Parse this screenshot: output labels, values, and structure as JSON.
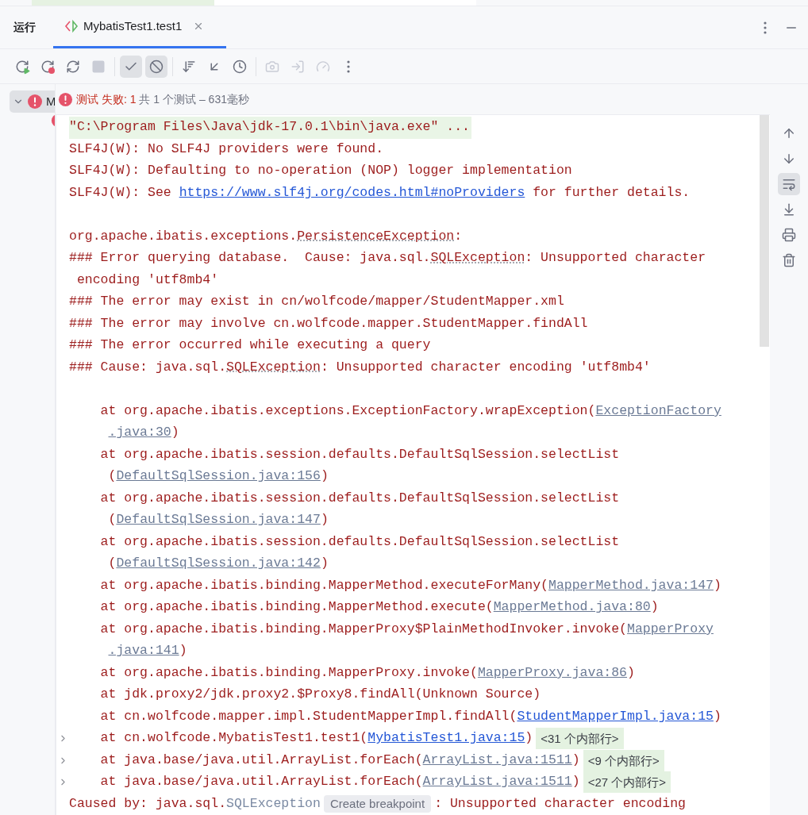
{
  "tool_window": {
    "title": "运行",
    "tabs": [
      {
        "label": "MybatisTest1.test1",
        "selected": true
      }
    ]
  },
  "toolbar": [
    {
      "kind": "rerun",
      "selected": false,
      "disabled": false
    },
    {
      "kind": "rerun_failed",
      "selected": false,
      "disabled": false
    },
    {
      "kind": "toggle_auto",
      "selected": false,
      "disabled": false
    },
    {
      "kind": "stop",
      "selected": false,
      "disabled": true
    },
    {
      "kind": "sep"
    },
    {
      "kind": "show_passed",
      "selected": true,
      "disabled": false
    },
    {
      "kind": "show_ignored",
      "selected": true,
      "disabled": false
    },
    {
      "kind": "sep"
    },
    {
      "kind": "sort",
      "selected": false,
      "disabled": false
    },
    {
      "kind": "collapse",
      "selected": false,
      "disabled": false
    },
    {
      "kind": "history",
      "selected": false,
      "disabled": false
    },
    {
      "kind": "sep"
    },
    {
      "kind": "snapshot",
      "selected": false,
      "disabled": true
    },
    {
      "kind": "import",
      "selected": false,
      "disabled": true
    },
    {
      "kind": "profile",
      "selected": false,
      "disabled": true
    },
    {
      "kind": "more",
      "selected": false
    }
  ],
  "tree": {
    "items": [
      {
        "label": "M",
        "failed": true,
        "selected": true,
        "expanded": true,
        "children": [
          {
            "failed": true
          }
        ]
      }
    ]
  },
  "status": {
    "result": "测试 失败: 1",
    "summary": "共 1 个测试 – 631毫秒"
  },
  "console": {
    "lines": [
      {
        "highlight": true,
        "segments": [
          {
            "kind": "plain",
            "text": "\"C:\\Program Files\\Java\\jdk-17.0.1\\bin\\java.exe\" ..."
          }
        ]
      },
      {
        "segments": [
          {
            "kind": "plain",
            "text": "SLF4J(W): No SLF4J providers were found."
          }
        ]
      },
      {
        "segments": [
          {
            "kind": "plain",
            "text": "SLF4J(W): Defaulting to no-operation (NOP) logger implementation"
          }
        ]
      },
      {
        "segments": [
          {
            "kind": "plain",
            "text": "SLF4J(W): See "
          },
          {
            "kind": "link",
            "text": "https://www.slf4j.org/codes.html#noProviders"
          },
          {
            "kind": "plain",
            "text": " for further details."
          }
        ]
      },
      {
        "kind": "blank"
      },
      {
        "segments": [
          {
            "kind": "plain",
            "text": "org.apache.ibatis.exceptions."
          },
          {
            "kind": "class_ref",
            "text": "PersistenceException"
          },
          {
            "kind": "plain",
            "text": ":"
          }
        ]
      },
      {
        "segments": [
          {
            "kind": "plain",
            "text": "### Error querying database.  Cause: java.sql."
          },
          {
            "kind": "class_ref",
            "text": "SQLException"
          },
          {
            "kind": "plain",
            "text": ": Unsupported character"
          }
        ]
      },
      {
        "segments": [
          {
            "kind": "plain",
            "text": " encoding 'utf8mb4'"
          }
        ]
      },
      {
        "segments": [
          {
            "kind": "plain",
            "text": "### The error may exist in cn/wolfcode/mapper/StudentMapper.xml"
          }
        ]
      },
      {
        "segments": [
          {
            "kind": "plain",
            "text": "### The error may involve cn.wolfcode.mapper.StudentMapper.findAll"
          }
        ]
      },
      {
        "segments": [
          {
            "kind": "plain",
            "text": "### The error occurred while executing a query"
          }
        ]
      },
      {
        "segments": [
          {
            "kind": "plain",
            "text": "### Cause: java.sql."
          },
          {
            "kind": "class_ref",
            "text": "SQLException"
          },
          {
            "kind": "plain",
            "text": ": Unsupported character encoding 'utf8mb4'"
          }
        ]
      },
      {
        "kind": "blank"
      },
      {
        "segments": [
          {
            "kind": "plain",
            "text": "    at org.apache.ibatis.exceptions.ExceptionFactory.wrapException("
          },
          {
            "kind": "file_link",
            "text": "ExceptionFactory"
          }
        ]
      },
      {
        "kind": "continuation",
        "segments": [
          {
            "kind": "file_link",
            "text": ".java:30"
          },
          {
            "kind": "plain",
            "text": ")"
          }
        ]
      },
      {
        "segments": [
          {
            "kind": "plain",
            "text": "    at org.apache.ibatis.session.defaults.DefaultSqlSession.selectList"
          }
        ]
      },
      {
        "segments": [
          {
            "kind": "plain",
            "text": "     ("
          },
          {
            "kind": "file_link",
            "text": "DefaultSqlSession.java:156"
          },
          {
            "kind": "plain",
            "text": ")"
          }
        ]
      },
      {
        "segments": [
          {
            "kind": "plain",
            "text": "    at org.apache.ibatis.session.defaults.DefaultSqlSession.selectList"
          }
        ]
      },
      {
        "segments": [
          {
            "kind": "plain",
            "text": "     ("
          },
          {
            "kind": "file_link",
            "text": "DefaultSqlSession.java:147"
          },
          {
            "kind": "plain",
            "text": ")"
          }
        ]
      },
      {
        "segments": [
          {
            "kind": "plain",
            "text": "    at org.apache.ibatis.session.defaults.DefaultSqlSession.selectList"
          }
        ]
      },
      {
        "segments": [
          {
            "kind": "plain",
            "text": "     ("
          },
          {
            "kind": "file_link",
            "text": "DefaultSqlSession.java:142"
          },
          {
            "kind": "plain",
            "text": ")"
          }
        ]
      },
      {
        "segments": [
          {
            "kind": "plain",
            "text": "    at org.apache.ibatis.binding.MapperMethod.executeForMany("
          },
          {
            "kind": "file_link",
            "text": "MapperMethod.java:147"
          },
          {
            "kind": "plain",
            "text": ")"
          }
        ]
      },
      {
        "segments": [
          {
            "kind": "plain",
            "text": "    at org.apache.ibatis.binding.MapperMethod.execute("
          },
          {
            "kind": "file_link",
            "text": "MapperMethod.java:80"
          },
          {
            "kind": "plain",
            "text": ")"
          }
        ]
      },
      {
        "segments": [
          {
            "kind": "plain",
            "text": "    at org.apache.ibatis.binding.MapperProxy$PlainMethodInvoker.invoke("
          },
          {
            "kind": "file_link",
            "text": "MapperProxy"
          }
        ]
      },
      {
        "kind": "continuation",
        "segments": [
          {
            "kind": "file_link",
            "text": ".java:141"
          },
          {
            "kind": "plain",
            "text": ")"
          }
        ]
      },
      {
        "segments": [
          {
            "kind": "plain",
            "text": "    at org.apache.ibatis.binding.MapperProxy.invoke("
          },
          {
            "kind": "file_link",
            "text": "MapperProxy.java:86"
          },
          {
            "kind": "plain",
            "text": ")"
          }
        ]
      },
      {
        "segments": [
          {
            "kind": "plain",
            "text": "    at jdk.proxy2/jdk.proxy2.$Proxy8.findAll(Unknown Source)"
          }
        ]
      },
      {
        "segments": [
          {
            "kind": "plain",
            "text": "    at cn.wolfcode.mapper.impl.StudentMapperImpl.findAll("
          },
          {
            "kind": "link",
            "text": "StudentMapperImpl.java:15"
          },
          {
            "kind": "plain",
            "text": ")"
          }
        ]
      },
      {
        "expandable": true,
        "segments": [
          {
            "kind": "plain",
            "text": "    at cn.wolfcode.MybatisTest1.test1("
          },
          {
            "kind": "link",
            "text": "MybatisTest1.java:15"
          },
          {
            "kind": "plain",
            "text": ")"
          },
          {
            "kind": "fold",
            "text": "<31 个内部行>"
          }
        ]
      },
      {
        "expandable": true,
        "segments": [
          {
            "kind": "plain",
            "text": "    at java.base/java.util.ArrayList.forEach("
          },
          {
            "kind": "file_link",
            "text": "ArrayList.java:1511"
          },
          {
            "kind": "plain",
            "text": ")"
          },
          {
            "kind": "fold",
            "text": "<9 个内部行>"
          }
        ]
      },
      {
        "expandable": true,
        "segments": [
          {
            "kind": "plain",
            "text": "    at java.base/java.util.ArrayList.forEach("
          },
          {
            "kind": "file_link",
            "text": "ArrayList.java:1511"
          },
          {
            "kind": "plain",
            "text": ")"
          },
          {
            "kind": "fold",
            "text": "<27 个内部行>"
          }
        ]
      },
      {
        "segments": [
          {
            "kind": "plain",
            "text": "Caused by: java.sql."
          },
          {
            "kind": "muted",
            "text": "SQLException"
          },
          {
            "kind": "hint",
            "text": "Create breakpoint"
          },
          {
            "kind": "plain",
            "text": ": Unsupported character encoding"
          }
        ]
      }
    ]
  },
  "side_actions": [
    {
      "kind": "up",
      "selected": false
    },
    {
      "kind": "down",
      "selected": false
    },
    {
      "kind": "soft_wrap",
      "selected": true
    },
    {
      "kind": "scroll_end",
      "selected": false
    },
    {
      "kind": "print",
      "selected": false
    },
    {
      "kind": "clear",
      "selected": false
    }
  ]
}
